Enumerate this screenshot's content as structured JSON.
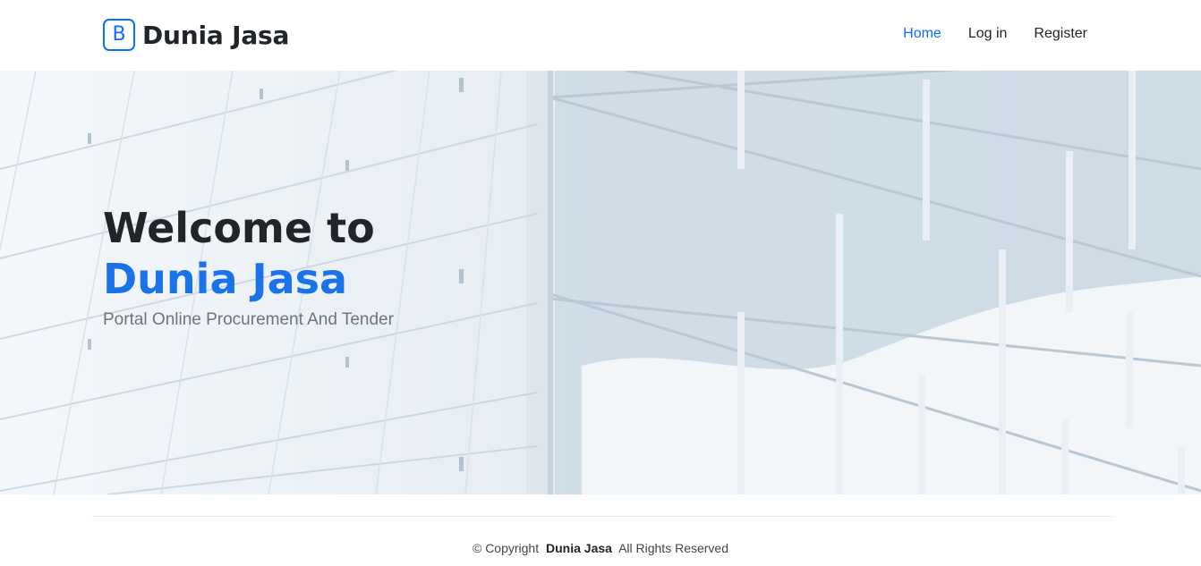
{
  "header": {
    "brand_letter": "B",
    "brand_name": "Dunia Jasa",
    "nav": [
      {
        "label": "Home",
        "active": true
      },
      {
        "label": "Log in",
        "active": false
      },
      {
        "label": "Register",
        "active": false
      }
    ]
  },
  "hero": {
    "title_line1": "Welcome to",
    "title_line2": "Dunia Jasa",
    "subtitle": "Portal Online Procurement And Tender"
  },
  "footer": {
    "copyright_prefix": "© Copyright",
    "company": "Dunia Jasa",
    "rights": "All Rights Reserved"
  },
  "colors": {
    "accent": "#0d6efd",
    "hero_accent": "#1a73e8",
    "text": "#212529",
    "muted": "#6c757d"
  }
}
